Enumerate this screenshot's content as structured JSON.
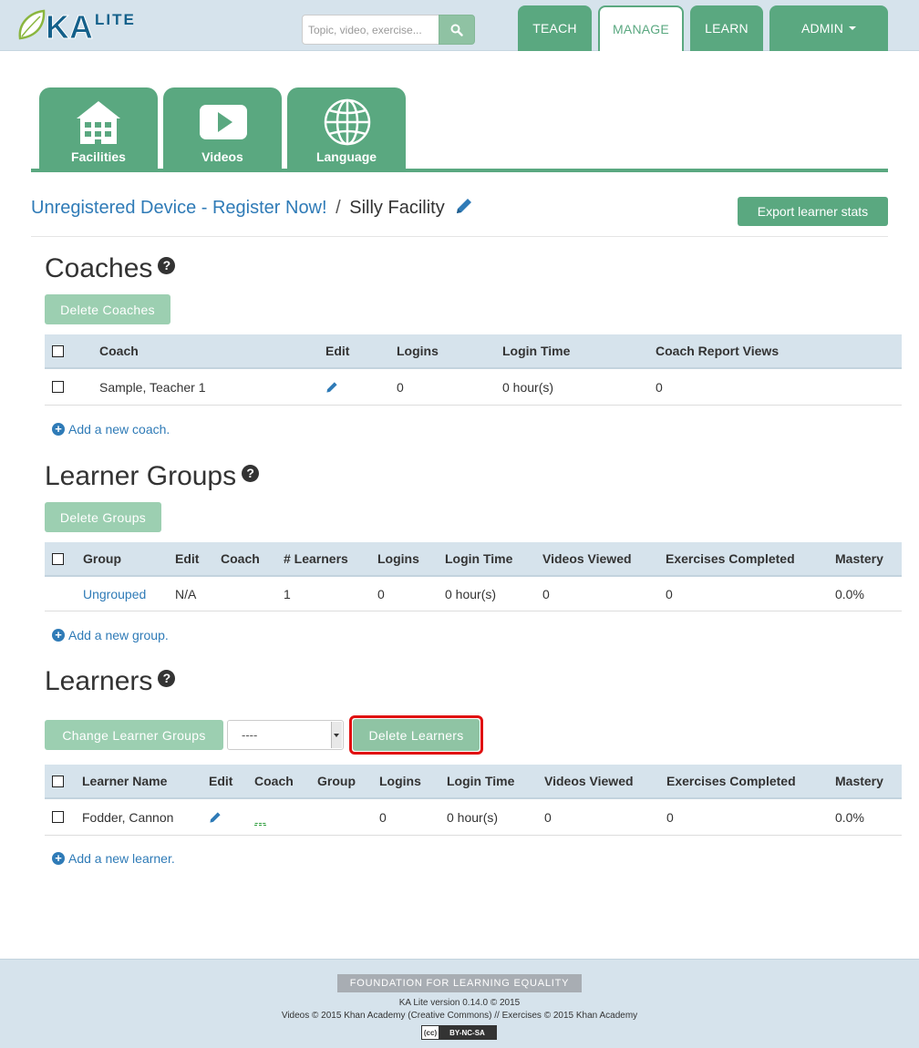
{
  "header": {
    "logo_text": "KA LITE",
    "search_placeholder": "Topic, video, exercise...",
    "nav": [
      {
        "label": "TEACH"
      },
      {
        "label": "MANAGE",
        "active": true
      },
      {
        "label": "LEARN"
      },
      {
        "label": "ADMIN"
      }
    ]
  },
  "icon_tabs": [
    {
      "label": "Facilities",
      "icon": "building-icon"
    },
    {
      "label": "Videos",
      "icon": "play-icon"
    },
    {
      "label": "Language",
      "icon": "globe-icon"
    }
  ],
  "breadcrumb": {
    "device_link": "Unregistered Device - Register Now!",
    "separator": "/",
    "facility": "Silly Facility"
  },
  "export_button": "Export learner stats",
  "coaches": {
    "title": "Coaches",
    "delete_button": "Delete Coaches",
    "columns": [
      "Coach",
      "Edit",
      "Logins",
      "Login Time",
      "Coach Report Views"
    ],
    "rows": [
      {
        "coach": "Sample, Teacher 1",
        "logins": "0",
        "login_time": "0 hour(s)",
        "report_views": "0"
      }
    ],
    "add_link": "Add a new coach."
  },
  "groups": {
    "title": "Learner Groups",
    "delete_button": "Delete Groups",
    "columns": [
      "Group",
      "Edit",
      "Coach",
      "# Learners",
      "Logins",
      "Login Time",
      "Videos Viewed",
      "Exercises Completed",
      "Mastery"
    ],
    "rows": [
      {
        "group": "Ungrouped",
        "edit": "N/A",
        "coach": "",
        "learners": "1",
        "logins": "0",
        "login_time": "0 hour(s)",
        "videos": "0",
        "exercises": "0",
        "mastery": "0.0%"
      }
    ],
    "add_link": "Add a new group."
  },
  "learners": {
    "title": "Learners",
    "change_button": "Change Learner Groups",
    "group_select": "----",
    "delete_button": "Delete Learners",
    "columns": [
      "Learner Name",
      "Edit",
      "Coach",
      "Group",
      "Logins",
      "Login Time",
      "Videos Viewed",
      "Exercises Completed",
      "Mastery"
    ],
    "rows": [
      {
        "name": "Fodder, Cannon",
        "coach": "---",
        "group": "",
        "logins": "0",
        "login_time": "0 hour(s)",
        "videos": "0",
        "exercises": "0",
        "mastery": "0.0%"
      }
    ],
    "add_link": "Add a new learner."
  },
  "footer": {
    "org": "FOUNDATION FOR LEARNING EQUALITY",
    "version": "KA Lite version 0.14.0 © 2015",
    "credits": "Videos © 2015 Khan Academy (Creative Commons) // Exercises © 2015 Khan Academy",
    "license": "BY-NC-SA"
  },
  "colors": {
    "accent": "#5aa880",
    "header_bg": "#d6e3ec",
    "link": "#2f7bb7",
    "highlight": "#e01010"
  }
}
